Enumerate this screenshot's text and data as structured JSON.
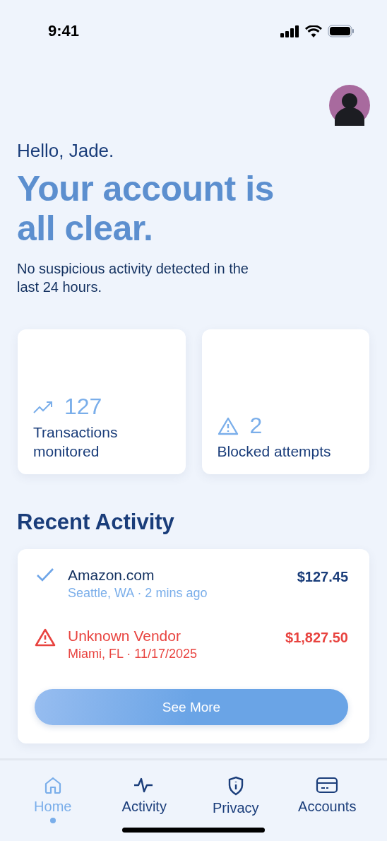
{
  "status_bar": {
    "time": "9:41"
  },
  "greeting": "Hello, Jade.",
  "headline": "Your account is all clear.",
  "subtitle": "No suspicious activity detected in the last 24 hours.",
  "stats": [
    {
      "kind": "trend",
      "value": "127",
      "label": "Transactions monitored"
    },
    {
      "kind": "warning",
      "value": "2",
      "label": "Blocked attempts"
    }
  ],
  "recent_activity": {
    "title": "Recent Activity",
    "transactions": [
      {
        "kind": "ok",
        "merchant": "Amazon.com",
        "detail": "Seattle, WA · 2 mins ago",
        "amount": "$127.45"
      },
      {
        "kind": "alert",
        "merchant": "Unknown Vendor",
        "detail": "Miami, FL · 11/17/2025",
        "amount": "$1,827.50"
      }
    ],
    "button": "See More"
  },
  "tabs": [
    {
      "kind": "home",
      "label": "Home",
      "selected": true
    },
    {
      "kind": "activity",
      "label": "Activity",
      "selected": false
    },
    {
      "kind": "privacy",
      "label": "Privacy",
      "selected": false
    },
    {
      "kind": "accounts",
      "label": "Accounts",
      "selected": false
    }
  ]
}
